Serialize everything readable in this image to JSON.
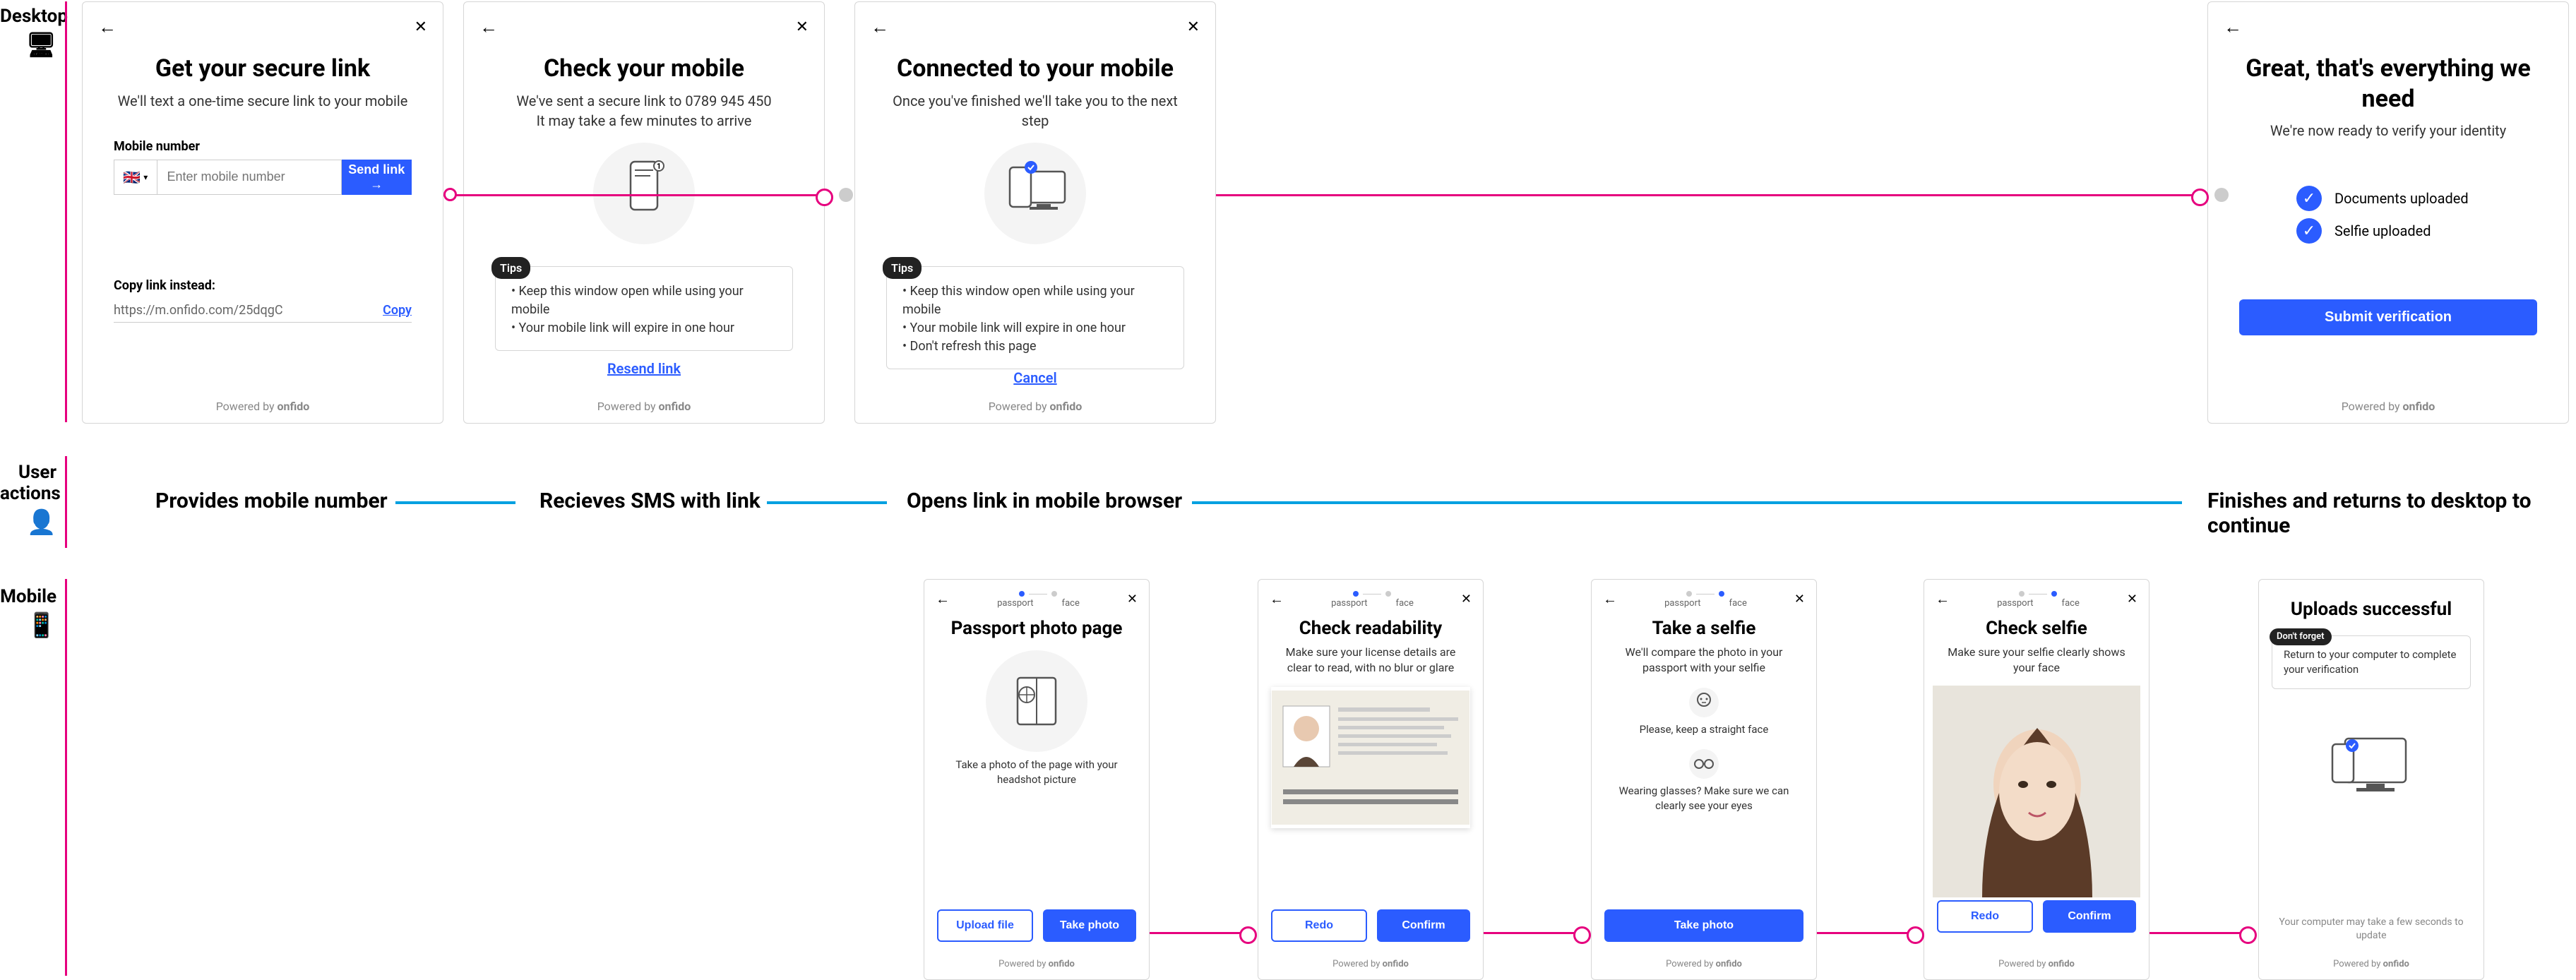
{
  "labels": {
    "desktop": "Desktop",
    "actions_l1": "User",
    "actions_l2": "actions",
    "mobile": "Mobile"
  },
  "desktop": {
    "s1": {
      "title": "Get your secure link",
      "sub": "We'll text a one-time secure link to your mobile",
      "field_label": "Mobile number",
      "placeholder": "Enter mobile number",
      "send": "Send link",
      "copy_label": "Copy link instead:",
      "url": "https://m.onfido.com/25dqgC",
      "copy": "Copy"
    },
    "s2": {
      "title": "Check your mobile",
      "sub1": "We've sent a secure link to 0789 945 450",
      "sub2": "It may take a few minutes to arrive",
      "tips": "Tips",
      "tip1": "Keep this window open while using your mobile",
      "tip2": "Your mobile link will expire in one hour",
      "resend": "Resend link"
    },
    "s3": {
      "title": "Connected to your mobile",
      "sub": "Once you've finished we'll take you to the next step",
      "tips": "Tips",
      "tip1": "Keep this window open while using your mobile",
      "tip2": "Your mobile link will expire in one hour",
      "tip3": "Don't refresh this page",
      "cancel": "Cancel"
    },
    "s4": {
      "title": "Great, that's everything we need",
      "sub": "We're now ready to verify your identity",
      "c1": "Documents uploaded",
      "c2": "Selfie uploaded",
      "submit": "Submit verification"
    }
  },
  "actions": {
    "a1": "Provides mobile number",
    "a2": "Recieves SMS with link",
    "a3": "Opens link in mobile browser",
    "a4": "Finishes and returns to desktop to continue"
  },
  "mobile": {
    "steps": {
      "p": "passport",
      "f": "face"
    },
    "m1": {
      "title": "Passport photo page",
      "sub": "",
      "desc": "Take a photo of the page with your headshot picture",
      "upload": "Upload file",
      "take": "Take photo"
    },
    "m2": {
      "title": "Check readability",
      "sub": "Make sure your license details are clear to read, with no blur or glare",
      "redo": "Redo",
      "confirm": "Confirm"
    },
    "m3": {
      "title": "Take a selfie",
      "sub": "We'll compare the photo in your passport with your selfie",
      "hint1": "Please, keep a straight face",
      "hint2": "Wearing glasses? Make sure we can clearly see your eyes",
      "take": "Take photo"
    },
    "m4": {
      "title": "Check selfie",
      "sub": "Make sure your selfie clearly shows your face",
      "redo": "Redo",
      "confirm": "Confirm"
    },
    "m5": {
      "title": "Uploads successful",
      "tag": "Don't forget",
      "msg": "Return to your computer to complete your verification",
      "note": "Your computer may take a few seconds to update"
    }
  },
  "powered": "Powered by"
}
